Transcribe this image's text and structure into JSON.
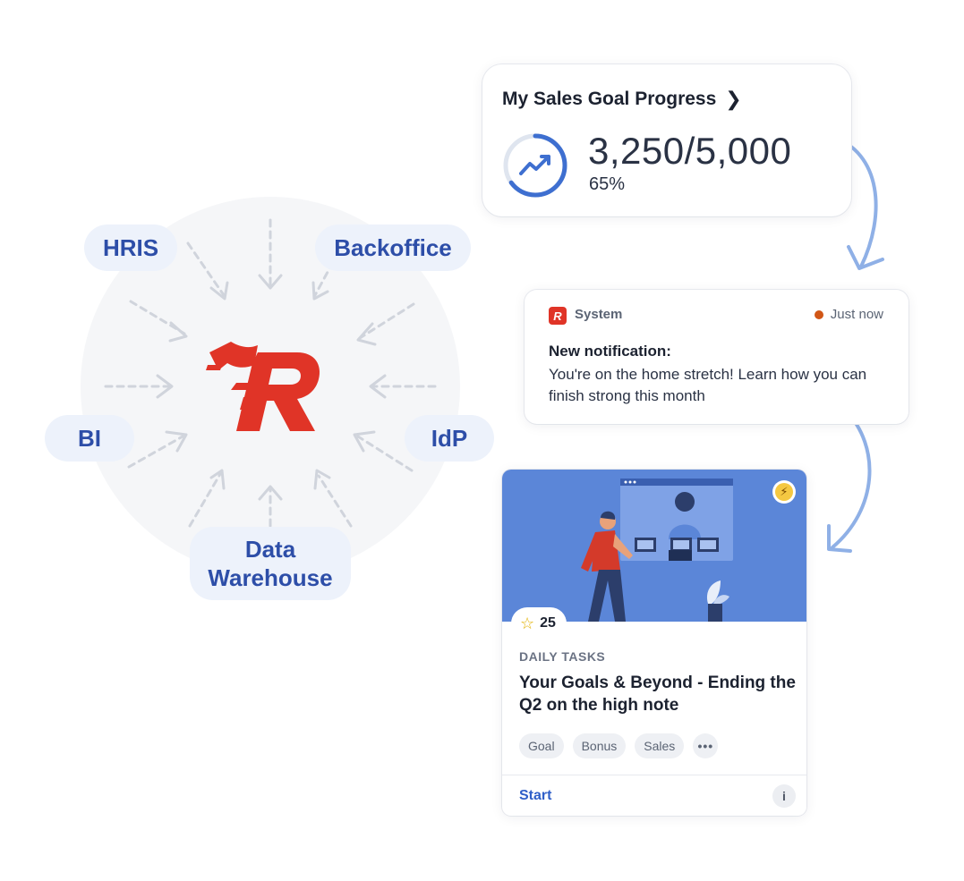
{
  "sources": {
    "hris": "HRIS",
    "backoffice": "Backoffice",
    "bi": "BI",
    "idp": "IdP",
    "data_warehouse_line1": "Data",
    "data_warehouse_line2": "Warehouse"
  },
  "goal_card": {
    "title": "My Sales Goal Progress",
    "value": "3,250/5,000",
    "percent_text": "65%",
    "progress": 0.65
  },
  "notification": {
    "sender": "System",
    "time": "Just now",
    "title": "New notification:",
    "body": "You're on the home stretch! Learn how you can finish strong this month"
  },
  "task_card": {
    "points": "25",
    "category": "DAILY TASKS",
    "title": "Your Goals & Beyond - Ending the Q2 on the high note",
    "tags": [
      "Goal",
      "Bonus",
      "Sales"
    ],
    "more": "•••",
    "start_label": "Start",
    "info_label": "i"
  },
  "colors": {
    "brand_red": "#e03427",
    "chip_bg": "#edf2fb",
    "chip_text": "#2d4ea8",
    "accent_blue": "#2f5fc8",
    "illustration_bg": "#5b86d8",
    "connector": "#8fb0e6"
  },
  "icons": {
    "goal_chevron": "chevron-right-icon",
    "goal_trend": "trend-up-icon",
    "status_dot": "status-dot-icon",
    "bolt": "lightning-icon",
    "star": "star-icon",
    "info": "info-icon"
  }
}
